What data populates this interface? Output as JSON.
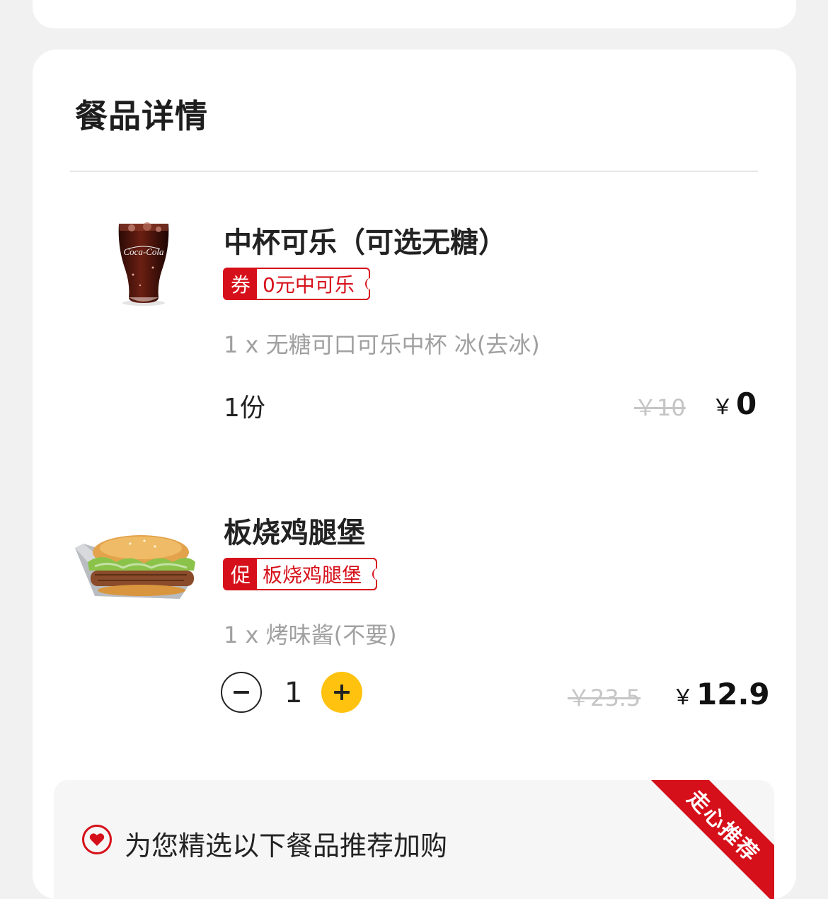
{
  "section": {
    "title": "餐品详情"
  },
  "items": [
    {
      "name": "中杯可乐（可选无糖）",
      "tag_type": "券",
      "tag_text": "0元中可乐",
      "spec": "1 x 无糖可口可乐中杯 冰(去冰)",
      "quantity_text": "1份",
      "original_price": "￥10",
      "currency": "￥",
      "price": "0",
      "image_icon": "cola-cup-image"
    },
    {
      "name": "板烧鸡腿堡",
      "tag_type": "促",
      "tag_text": "板烧鸡腿堡",
      "spec": "1 x 烤味酱(不要)",
      "quantity": "1",
      "original_price": "￥23.5",
      "currency": "￥",
      "price": "12.9",
      "image_icon": "chicken-burger-image"
    }
  ],
  "recommendation": {
    "text": "为您精选以下餐品推荐加购",
    "ribbon": "走心推荐"
  },
  "colors": {
    "accent_red": "#d6101a",
    "plus_yellow": "#ffc20e"
  }
}
